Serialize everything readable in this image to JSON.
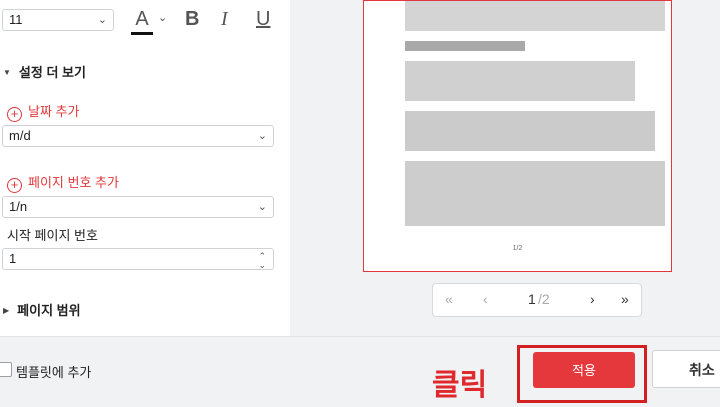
{
  "toolbar": {
    "font_size": "11",
    "text_color_glyph": "A",
    "bold_glyph": "B",
    "italic_glyph": "I",
    "underline_glyph": "U"
  },
  "settings": {
    "more_settings_label": "설정 더 보기",
    "add_date_label": "날짜 추가",
    "date_format": "m/d",
    "add_page_number_label": "페이지 번호 추가",
    "page_number_format": "1/n",
    "start_page_label": "시작 페이지 번호",
    "start_page_value": "1",
    "page_range_label": "페이지 범위"
  },
  "preview": {
    "page_indicator": "1/2",
    "current_page": "1",
    "total_pages": "/2"
  },
  "footer": {
    "add_template_label": "템플릿에 추가",
    "annotation": "클릭",
    "apply_label": "적용",
    "cancel_label": "취소"
  },
  "colors": {
    "accent": "#e5383c",
    "annotation": "#d21f22"
  }
}
